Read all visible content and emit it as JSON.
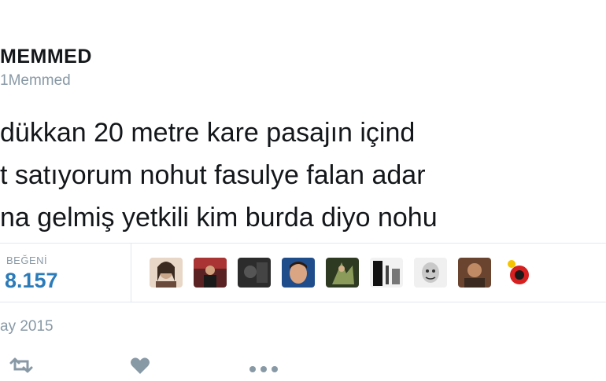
{
  "author": {
    "name": "MEMMED",
    "handle": "1Memmed"
  },
  "tweet": {
    "lines": [
      "dükkan 20 metre kare pasajın içind",
      "t satıyorum nohut fasulye falan adar",
      "na gelmiş yetkili kim burda diyo nohu"
    ]
  },
  "stats": {
    "likes_label": "BEĞENİ",
    "likes_count": "8.157"
  },
  "liker_avatars": [
    {
      "name": "liker-avatar-1",
      "bg": "#c9a58a"
    },
    {
      "name": "liker-avatar-2",
      "bg": "#7a2a2a"
    },
    {
      "name": "liker-avatar-3",
      "bg": "#3a3a3a"
    },
    {
      "name": "liker-avatar-4",
      "bg": "#1f4d8c"
    },
    {
      "name": "liker-avatar-5",
      "bg": "#556b2f"
    },
    {
      "name": "liker-avatar-6",
      "bg": "#222222"
    },
    {
      "name": "liker-avatar-7",
      "bg": "#d0d0d0"
    },
    {
      "name": "liker-avatar-8",
      "bg": "#8a5a3a"
    },
    {
      "name": "liker-avatar-9",
      "bg": "#ffffff"
    }
  ],
  "date": "ay 2015",
  "actions": {
    "retweet_icon": "retweet-icon",
    "like_icon": "heart-icon",
    "more_icon": "more-dots-icon"
  },
  "colors": {
    "accent": "#2b7bb9",
    "muted": "#8899a6",
    "border": "#e1e8ed"
  }
}
